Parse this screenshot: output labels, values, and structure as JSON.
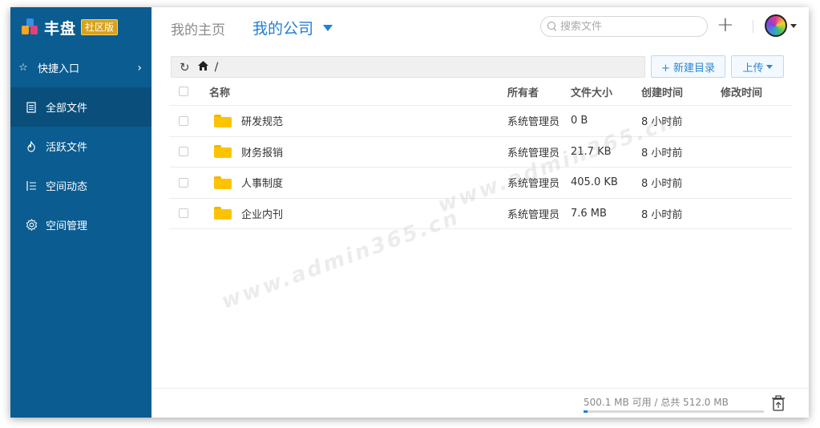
{
  "brand": {
    "name": "丰盘",
    "badge": "社区版"
  },
  "sidebar": {
    "items": [
      {
        "label": "快捷入口",
        "icon": "star-icon"
      },
      {
        "label": "全部文件",
        "icon": "document-icon"
      },
      {
        "label": "活跃文件",
        "icon": "flame-icon"
      },
      {
        "label": "空间动态",
        "icon": "activity-list-icon"
      },
      {
        "label": "空间管理",
        "icon": "gear-icon"
      }
    ],
    "active_index": 1
  },
  "topbar": {
    "tab_home": "我的主页",
    "tab_company": "我的公司",
    "search_placeholder": "搜索文件"
  },
  "path": {
    "root": "/"
  },
  "toolbar": {
    "new_dir_label": "+ 新建目录",
    "upload_label": "上传"
  },
  "table": {
    "headers": {
      "name": "名称",
      "owner": "所有者",
      "size": "文件大小",
      "created": "创建时间",
      "modified": "修改时间"
    },
    "rows": [
      {
        "name": "研发规范",
        "owner": "系统管理员",
        "size": "0 B",
        "created": "8 小时前",
        "modified": ""
      },
      {
        "name": "财务报销",
        "owner": "系统管理员",
        "size": "21.7 KB",
        "created": "8 小时前",
        "modified": ""
      },
      {
        "name": "人事制度",
        "owner": "系统管理员",
        "size": "405.0 KB",
        "created": "8 小时前",
        "modified": ""
      },
      {
        "name": "企业内刊",
        "owner": "系统管理员",
        "size": "7.6 MB",
        "created": "8 小时前",
        "modified": ""
      }
    ]
  },
  "footer": {
    "quota_text": "500.1 MB 可用 / 总共 512.0 MB",
    "used_fraction": 0.023
  },
  "watermark": "www.admin365.cn",
  "colors": {
    "sidebar": "#0a5c91",
    "accent": "#1f7fd6",
    "folder": "#fcc400"
  }
}
